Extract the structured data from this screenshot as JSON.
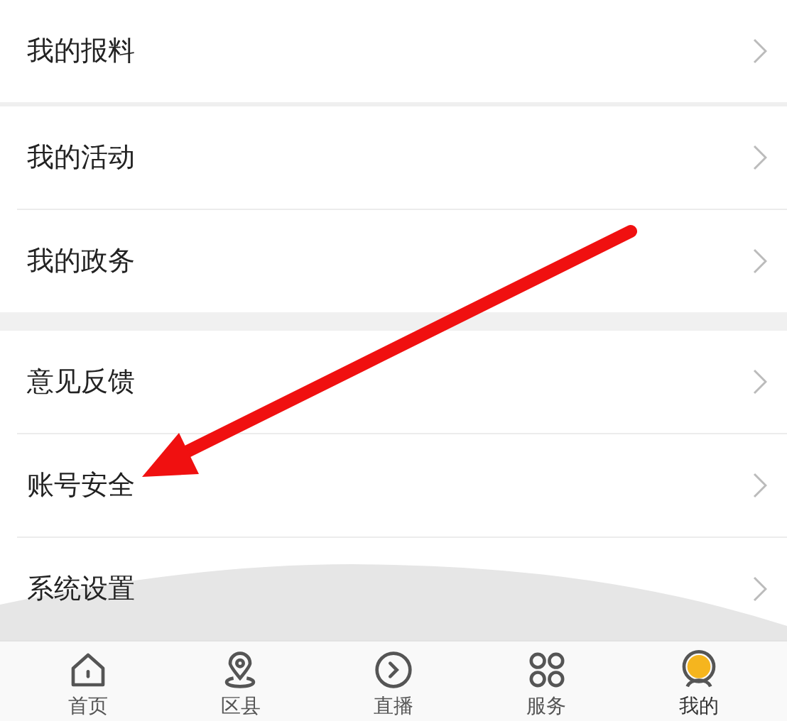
{
  "groups": [
    {
      "items": [
        {
          "label": "我的报料"
        }
      ]
    },
    {
      "items": [
        {
          "label": "我的活动"
        },
        {
          "label": "我的政务"
        }
      ]
    },
    {
      "items": [
        {
          "label": "意见反馈"
        },
        {
          "label": "账号安全"
        },
        {
          "label": "系统设置"
        }
      ]
    }
  ],
  "tab_bar": [
    {
      "label": "首页",
      "kind": "home",
      "selected": false
    },
    {
      "label": "区县",
      "kind": "pin",
      "selected": false
    },
    {
      "label": "直播",
      "kind": "play",
      "selected": false
    },
    {
      "label": "服务",
      "kind": "grid",
      "selected": false
    },
    {
      "label": "我的",
      "kind": "avatar",
      "selected": true
    }
  ]
}
